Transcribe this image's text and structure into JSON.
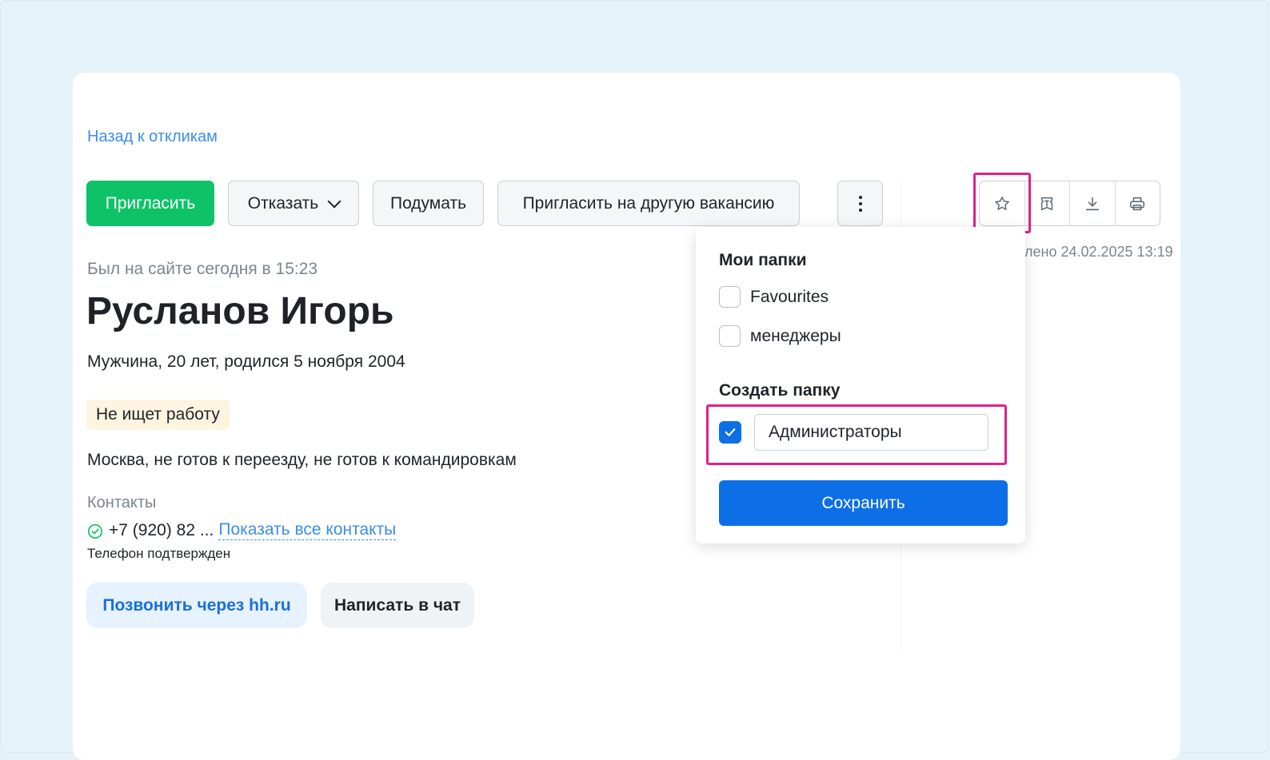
{
  "nav": {
    "back_link": "Назад к откликам"
  },
  "actions": {
    "invite": "Пригласить",
    "reject": "Отказать",
    "think": "Подумать",
    "invite_other": "Пригласить на другую вакансию"
  },
  "toolbar_icons": [
    "star-icon",
    "comment-icon",
    "download-icon",
    "print-icon"
  ],
  "meta": {
    "updated": "лено 24.02.2025 13:19"
  },
  "profile": {
    "last_seen": "Был на сайте сегодня в 15:23",
    "name": "Русланов Игорь",
    "details": "Мужчина, 20 лет, родился 5 ноября 2004",
    "status_badge": "Не ищет работу",
    "location": "Москва, не готов к переезду, не готов к командировкам",
    "contacts_label": "Контакты",
    "phone": "+7 (920) 82 ...",
    "show_contacts": "Показать все контакты",
    "phone_confirmed": "Телефон подтвержден",
    "call_button": "Позвонить через hh.ru",
    "chat_button": "Написать в чат"
  },
  "folders_popup": {
    "my_folders_title": "Мои папки",
    "folders": [
      {
        "label": "Favourites",
        "checked": false
      },
      {
        "label": "менеджеры",
        "checked": false
      }
    ],
    "create_title": "Создать папку",
    "new_folder_value": "Администраторы",
    "new_folder_checked": true,
    "save_button": "Сохранить"
  },
  "colors": {
    "primary_green": "#0dc267",
    "primary_blue": "#0d6fe6",
    "link_blue": "#3b8ee8",
    "highlight_magenta": "#e0218a"
  }
}
